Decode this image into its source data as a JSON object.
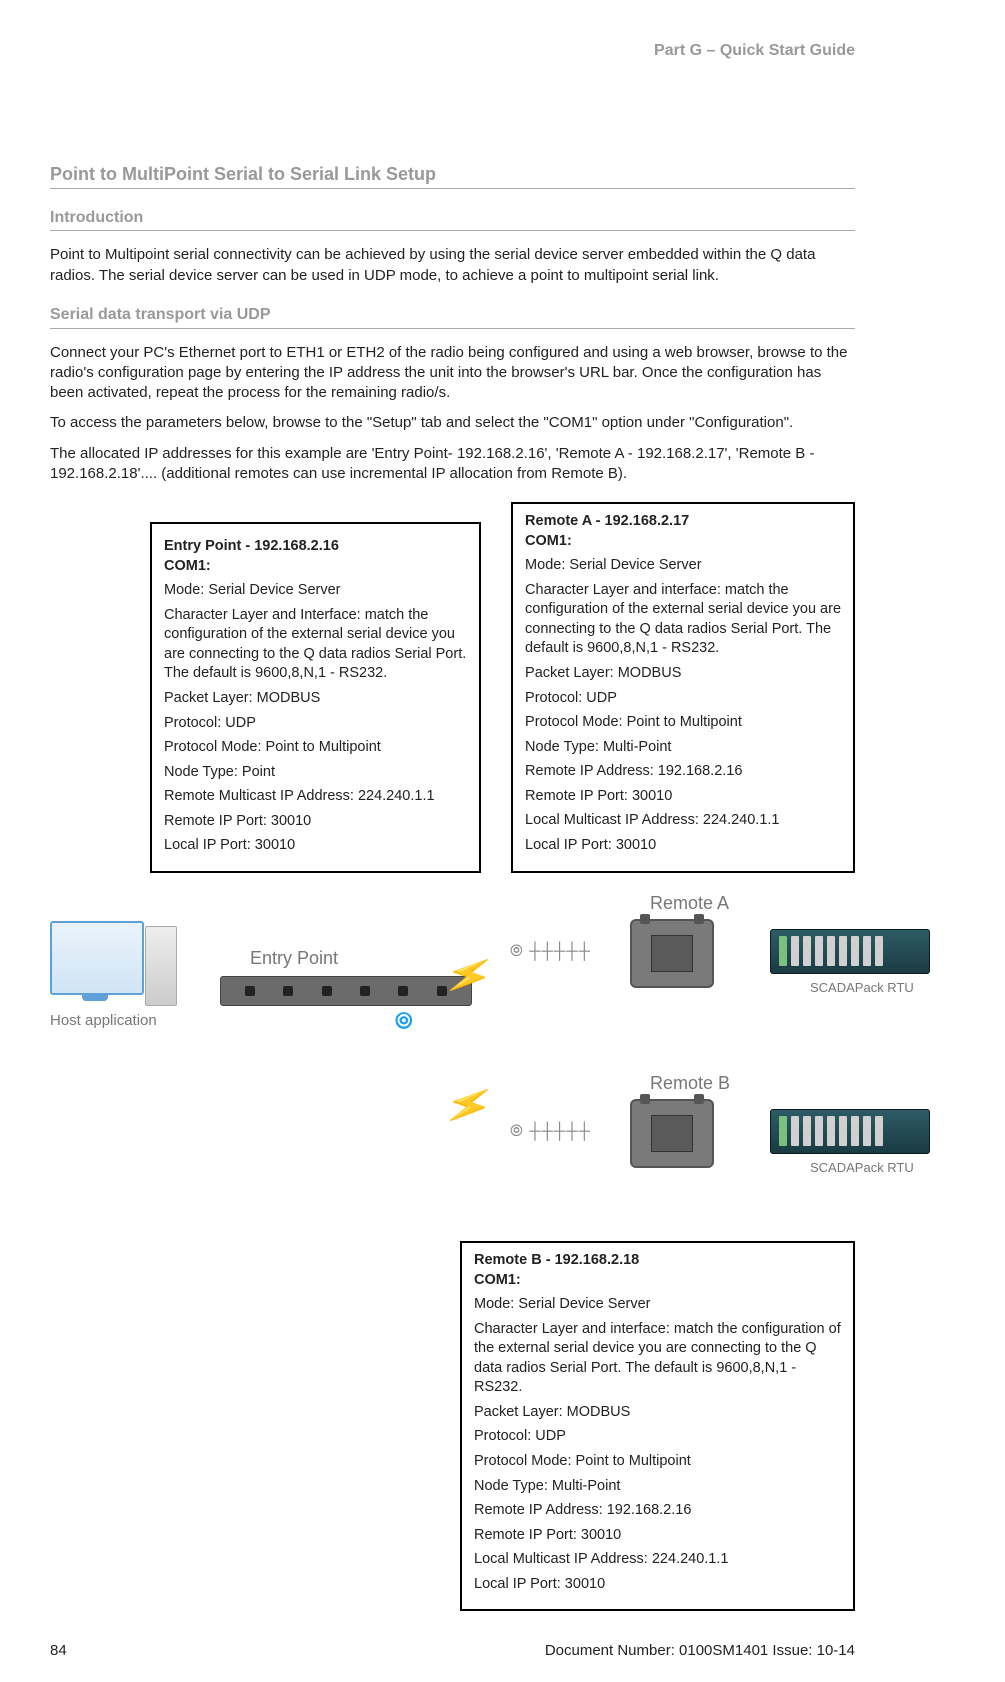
{
  "header": {
    "part": "Part G – Quick Start Guide"
  },
  "titles": {
    "main": "Point to MultiPoint Serial to Serial Link Setup",
    "intro": "Introduction",
    "udp": "Serial data transport via UDP"
  },
  "intro_para": "Point to Multipoint serial connectivity can be achieved by using the serial device server embedded within the Q data radios. The serial device server can be used in UDP mode, to achieve a point to multipoint serial link.",
  "udp_p1": "Connect your PC's Ethernet port to ETH1 or ETH2 of the radio being configured and using a web browser, browse to the radio's configuration page by entering the IP address the unit into the browser's URL bar.  Once the configuration has been activated, repeat the process for the remaining radio/s.",
  "udp_p2": "To access the parameters below, browse to the \"Setup\" tab and select the \"COM1\" option under \"Configuration\".",
  "udp_p3": "The allocated IP addresses for this example are 'Entry Point- 192.168.2.16', 'Remote A - 192.168.2.17', 'Remote B - 192.168.2.18'.... (additional remotes can use incremental IP allocation from Remote B).",
  "entry": {
    "title": "Entry Point - 192.168.2.16",
    "com": "COM1:",
    "l1": "Mode: Serial Device Server",
    "l2": "Character Layer and Interface: match the configuration of the external serial device you are connecting to the Q data radios Serial Port. The default is 9600,8,N,1 - RS232.",
    "l3": "Packet Layer: MODBUS",
    "l4": "Protocol: UDP",
    "l5": "Protocol Mode: Point to Multipoint",
    "l6": "Node Type: Point",
    "l7": "Remote Multicast IP Address: 224.240.1.1",
    "l8": "Remote IP Port: 30010",
    "l9": "Local IP Port: 30010"
  },
  "remoteA": {
    "title": "Remote A - 192.168.2.17",
    "com": "COM1:",
    "l1": "Mode: Serial Device Server",
    "l2": "Character Layer and interface: match the configuration of the external serial device you are connecting to the Q data radios Serial Port. The default is 9600,8,N,1 - RS232.",
    "l3": "Packet Layer: MODBUS",
    "l4": "Protocol: UDP",
    "l5": "Protocol Mode: Point to Multipoint",
    "l6": "Node Type: Multi-Point",
    "l7": "Remote IP Address: 192.168.2.16",
    "l8": "Remote IP Port: 30010",
    "l9": "Local Multicast IP Address: 224.240.1.1",
    "l10": "Local IP Port: 30010"
  },
  "remoteB": {
    "title": "Remote B - 192.168.2.18",
    "com": "COM1:",
    "l1": "Mode: Serial Device Server",
    "l2": "Character Layer and interface: match the configuration of the external serial device you are connecting to the Q data radios Serial Port. The default is 9600,8,N,1 - RS232.",
    "l3": "Packet Layer: MODBUS",
    "l4": "Protocol: UDP",
    "l5": "Protocol Mode: Point to Multipoint",
    "l6": "Node Type: Multi-Point",
    "l7": "Remote IP Address: 192.168.2.16",
    "l8": "Remote IP Port: 30010",
    "l9": "Local Multicast IP Address: 224.240.1.1",
    "l10": "Local IP Port: 30010"
  },
  "diagram": {
    "host": "Host application",
    "entry": "Entry Point",
    "ra": "Remote A",
    "rb": "Remote B",
    "scada": "SCADAPack RTU"
  },
  "footer": {
    "page": "84",
    "doc": "Document Number: 0100SM1401   Issue: 10-14"
  }
}
